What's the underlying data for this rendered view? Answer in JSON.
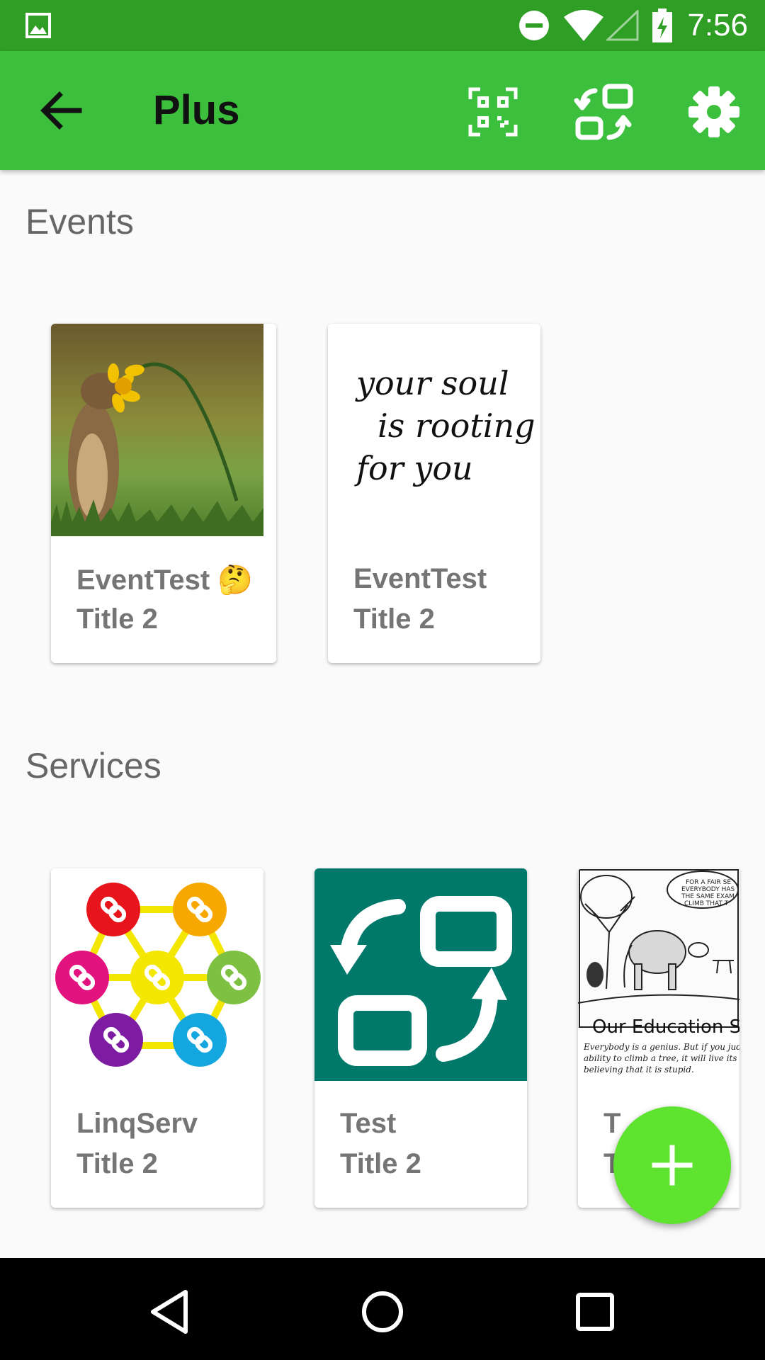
{
  "status_bar": {
    "time": "7:56",
    "icons": [
      "image-notification-icon",
      "do-not-disturb-icon",
      "wifi-icon",
      "no-signal-icon",
      "battery-charging-icon"
    ]
  },
  "app_bar": {
    "title": "Plus",
    "actions": [
      "qr-code-icon",
      "swap-icon",
      "settings-icon"
    ]
  },
  "colors": {
    "status_bar": "#2e9e24",
    "app_bar": "#3dbf3e",
    "fab": "#5ee32f",
    "teal_tile": "#00796b"
  },
  "events": {
    "title": "Events",
    "cards": [
      {
        "title": "EventTest",
        "emoji": "🤔",
        "subtitle": "Title 2",
        "image": "squirrel-flower-photo"
      },
      {
        "title": "EventTest",
        "subtitle": "Title 2",
        "image": "handwritten-quote"
      }
    ],
    "quote_lines": [
      "your soul",
      "is rooting",
      "for you"
    ]
  },
  "services": {
    "title": "Services",
    "cards": [
      {
        "title": "LinqServ",
        "subtitle": "Title 2",
        "image": "linked-chain-network-logo"
      },
      {
        "title": "Test",
        "subtitle": "Title 2",
        "image": "swap-arrows-tile"
      },
      {
        "title": "T",
        "subtitle": "T",
        "image": "education-cartoon"
      }
    ],
    "cartoon_caption": "Our Education Sy",
    "cartoon_bubble": [
      "FOR A FAIR SE",
      "EVERYBODY HAS",
      "THE SAME EXAM",
      "CLIMB THAT T"
    ],
    "cartoon_text": [
      "Everybody is a genius. But if you judge a",
      "ability to climb a tree, it will live its whole",
      "believing that it is stupid."
    ]
  },
  "fab": {
    "label": "+"
  }
}
